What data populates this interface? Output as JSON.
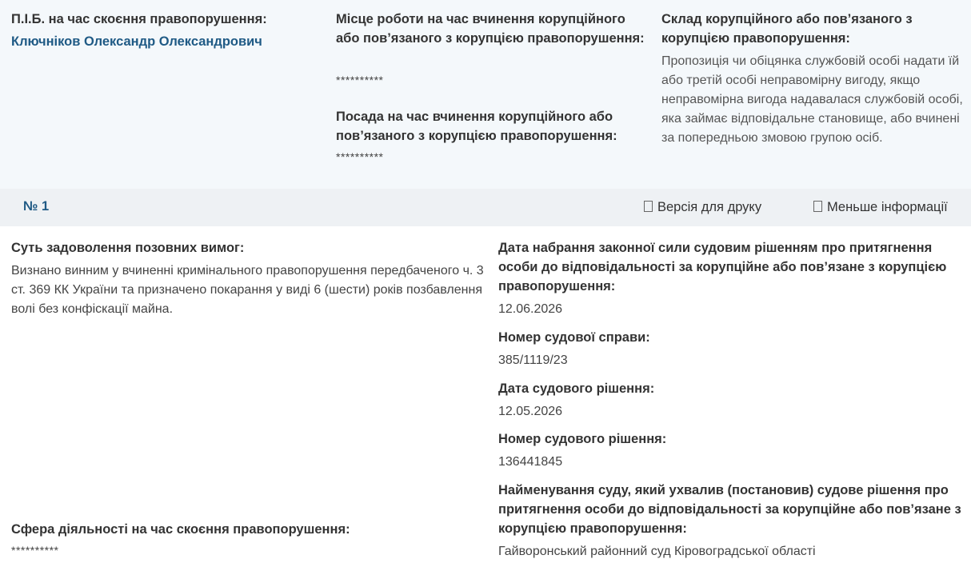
{
  "top": {
    "col1": {
      "label": "П.І.Б. на час скоєння правопорушення:",
      "value": "Ключніков Олександр Олександрович"
    },
    "col2": {
      "workplace_label": "Місце роботи на час вчинення корупційного або пов’язаного з корупцією правопорушення:",
      "workplace_value": "**********",
      "position_label": "Посада на час вчинення корупційного або пов’язаного з корупцією правопорушення:",
      "position_value": "**********"
    },
    "col3": {
      "label": "Склад корупційного або пов’язаного з корупцією правопорушення:",
      "value": "Пропозиція чи обіцянка службовій особі надати їй або третій особі неправомірну вигоду, якщо неправомірна вигода надавалася службовій особі, яка займає відповідальне становище, або вчинені за попередньою змовою групою осіб."
    }
  },
  "bar": {
    "number": "№ 1",
    "print_label": "Версія для друку",
    "less_label": "Меньше інформації"
  },
  "details": {
    "claim_label": "Суть задоволення позовних вимог:",
    "claim_value": "Визнано винним у вчиненні кримінального правопорушення передбаченого ч. 3 ст. 369 КК України та призначено покарання у виді 6 (шести) років позбавлення волі без конфіскації майна.",
    "sphere_label": "Сфера діяльності на час скоєння правопорушення:",
    "sphere_value": "**********",
    "effective_date_label": "Дата набрання законної сили судовим рішенням про притягнення особи до відповідальності за корупційне або пов’язане з корупцією правопорушення:",
    "effective_date_value": "12.06.2026",
    "case_number_label": "Номер судової справи:",
    "case_number_value": "385/1119/23",
    "decision_date_label": "Дата судового рішення:",
    "decision_date_value": "12.05.2026",
    "decision_number_label": "Номер судового рішення:",
    "decision_number_value": "136441845",
    "court_label": "Найменування суду, який ухвалив (постановив) судове рішення про притягнення особи до відповідальності за корупційне або пов’язане з корупцією правопорушення:",
    "court_value": "Гайворонський районний суд Кіровоградської області"
  }
}
